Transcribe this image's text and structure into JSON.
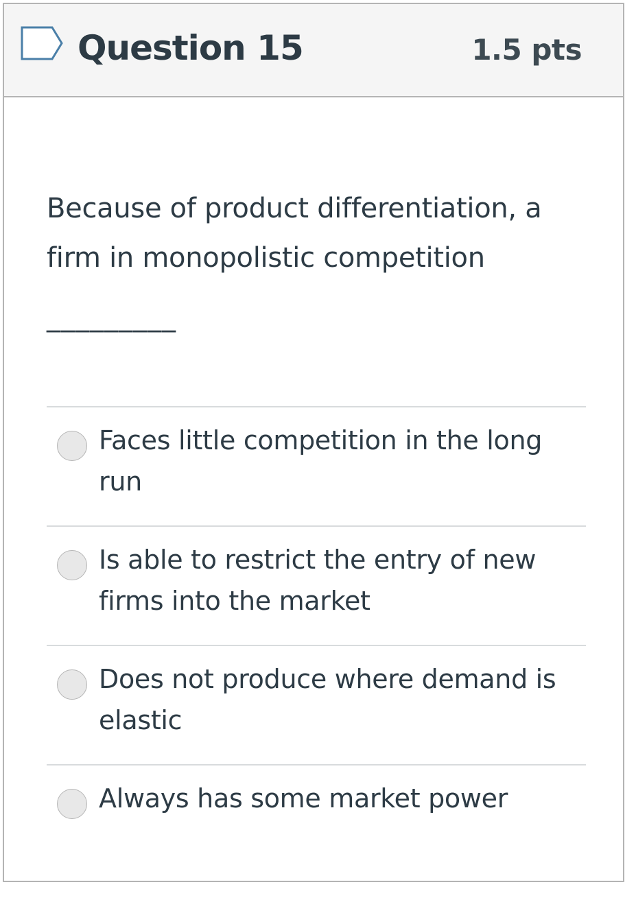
{
  "question": {
    "title": "Question 15",
    "points": "1.5 pts",
    "flag_icon": "flag-outline-icon",
    "text": "Because of product differentiation, a firm in monopolistic competition",
    "blank": "_________"
  },
  "answers": [
    {
      "label": "Faces little competition in the long run",
      "selected": false
    },
    {
      "label": "Is able to restrict the entry of new firms into the market",
      "selected": false
    },
    {
      "label": "Does not produce where demand is elastic",
      "selected": false
    },
    {
      "label": "Always has some market power",
      "selected": false
    }
  ],
  "colors": {
    "text": "#2d3b45",
    "header_bg": "#f5f5f5",
    "border": "#b4b4b4",
    "flag_stroke": "#4a7fa8"
  }
}
